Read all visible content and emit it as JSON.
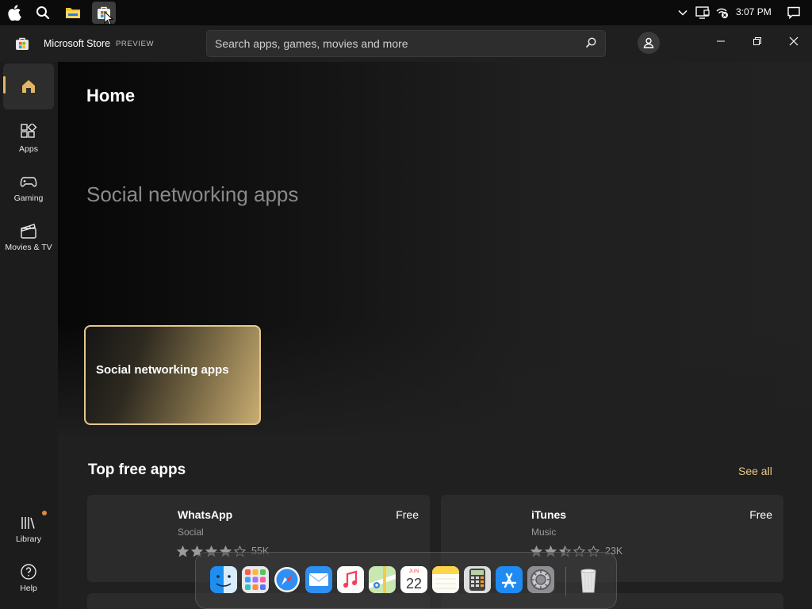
{
  "taskbar": {
    "icons": [
      "apple-icon",
      "search-icon",
      "file-explorer-icon",
      "microsoft-store-icon"
    ],
    "tray_icons": [
      "chevron-down-icon",
      "display-icon",
      "network-icon",
      "notification-icon"
    ],
    "time": "3:07 PM"
  },
  "window": {
    "title": "Microsoft Store",
    "badge": "PREVIEW",
    "search_placeholder": "Search apps, games, movies and more"
  },
  "sidebar": {
    "items": [
      {
        "id": "home",
        "label": "",
        "icon": "home-icon",
        "selected": true
      },
      {
        "id": "apps",
        "label": "Apps",
        "icon": "apps-icon",
        "selected": false
      },
      {
        "id": "gaming",
        "label": "Gaming",
        "icon": "gamepad-icon",
        "selected": false
      },
      {
        "id": "movies",
        "label": "Movies & TV",
        "icon": "clapperboard-icon",
        "selected": false
      }
    ],
    "bottom_items": [
      {
        "id": "library",
        "label": "Library",
        "icon": "library-icon",
        "has_badge": true
      },
      {
        "id": "help",
        "label": "Help",
        "icon": "help-icon",
        "has_badge": false
      }
    ]
  },
  "main": {
    "page_title": "Home",
    "hero_title": "Social networking apps",
    "hero_card_label": "Social networking apps",
    "section_title": "Top free apps",
    "see_all": "See all",
    "apps": [
      {
        "name": "WhatsApp",
        "category": "Social",
        "price": "Free",
        "rating": 4,
        "rating_count": "55K"
      },
      {
        "name": "iTunes",
        "category": "Music",
        "price": "Free",
        "rating": 2.5,
        "rating_count": "23K"
      }
    ]
  },
  "dock": {
    "icons": [
      "finder-icon",
      "launchpad-icon",
      "safari-icon",
      "mail-icon",
      "music-icon",
      "maps-icon",
      "calendar-icon",
      "notes-icon",
      "calculator-icon",
      "app-store-icon",
      "system-preferences-icon",
      "trash-icon"
    ],
    "calendar_month": "JUN",
    "calendar_day": "22"
  },
  "colors": {
    "accent": "#e2b563",
    "see_all": "#e8c987",
    "background": "#202020",
    "sidebar": "#1c1c1c"
  }
}
